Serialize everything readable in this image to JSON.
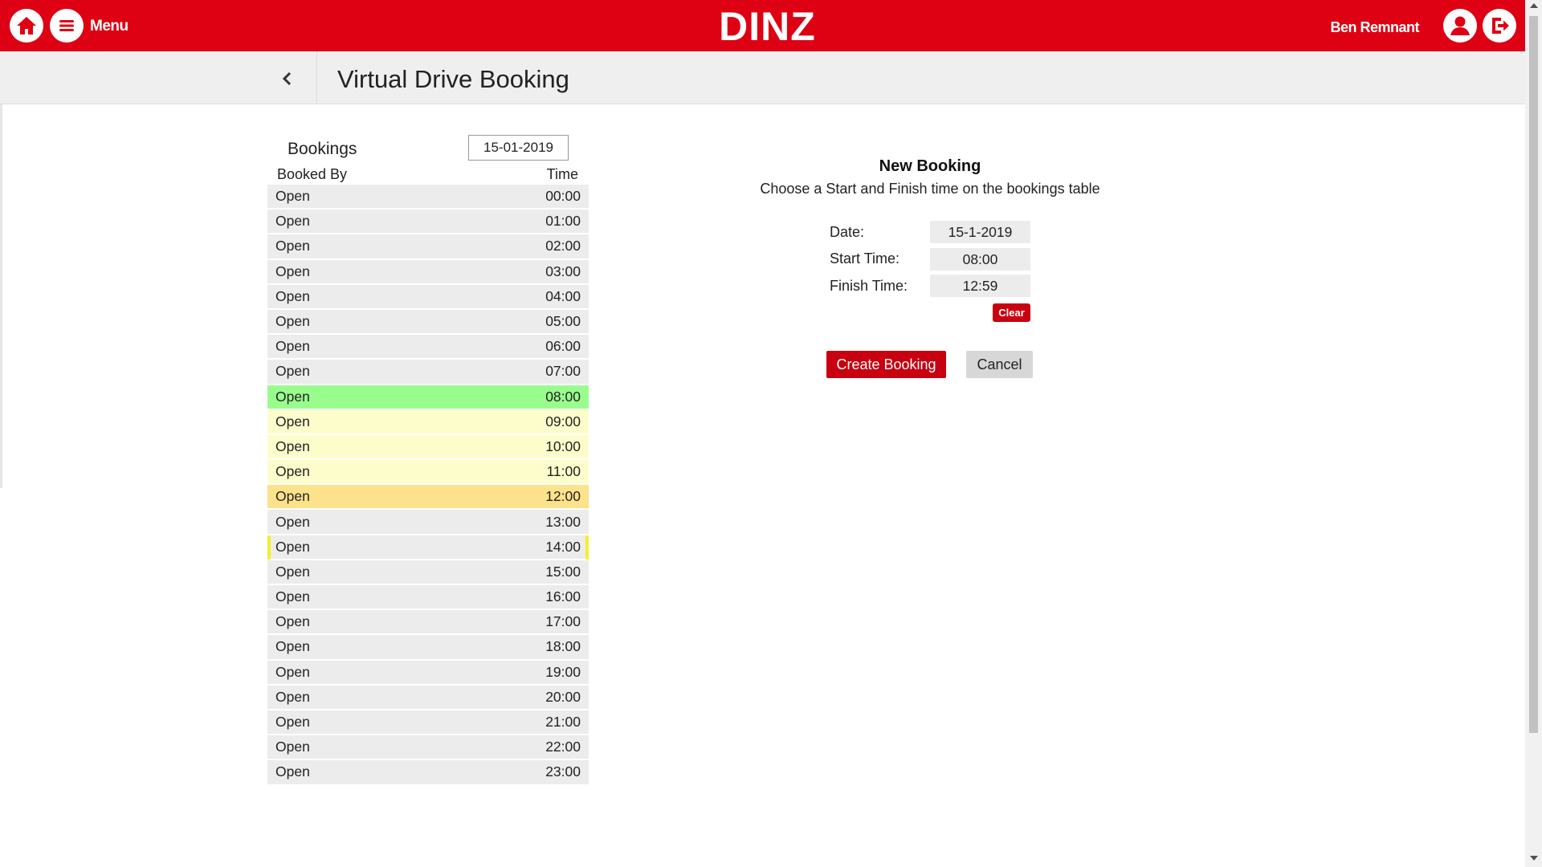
{
  "header": {
    "brand": "DINZ",
    "menu_label": "Menu",
    "user_name": "Ben Remnant",
    "brand_color": "#de0013",
    "icons": {
      "home": "home-icon",
      "menu": "hamburger-menu-icon",
      "user": "user-account-icon",
      "logout": "logout-icon"
    }
  },
  "page": {
    "title": "Virtual Drive Booking",
    "back_icon": "chevron-left-icon"
  },
  "bookings": {
    "label": "Bookings",
    "date": "15-01-2019",
    "col_booked_by": "Booked By",
    "col_time": "Time",
    "slot_colors": {
      "start": "#99fd8e",
      "range": "#fdfdcc",
      "finish": "#fde28c",
      "current_marker": "#f6ee2b",
      "default": "#ececec"
    },
    "slots": [
      {
        "booked_by": "Open",
        "time": "00:00",
        "state": "default"
      },
      {
        "booked_by": "Open",
        "time": "01:00",
        "state": "default"
      },
      {
        "booked_by": "Open",
        "time": "02:00",
        "state": "default"
      },
      {
        "booked_by": "Open",
        "time": "03:00",
        "state": "default"
      },
      {
        "booked_by": "Open",
        "time": "04:00",
        "state": "default"
      },
      {
        "booked_by": "Open",
        "time": "05:00",
        "state": "default"
      },
      {
        "booked_by": "Open",
        "time": "06:00",
        "state": "default"
      },
      {
        "booked_by": "Open",
        "time": "07:00",
        "state": "default"
      },
      {
        "booked_by": "Open",
        "time": "08:00",
        "state": "start"
      },
      {
        "booked_by": "Open",
        "time": "09:00",
        "state": "range"
      },
      {
        "booked_by": "Open",
        "time": "10:00",
        "state": "range"
      },
      {
        "booked_by": "Open",
        "time": "11:00",
        "state": "range"
      },
      {
        "booked_by": "Open",
        "time": "12:00",
        "state": "finish"
      },
      {
        "booked_by": "Open",
        "time": "13:00",
        "state": "default"
      },
      {
        "booked_by": "Open",
        "time": "14:00",
        "state": "current"
      },
      {
        "booked_by": "Open",
        "time": "15:00",
        "state": "default"
      },
      {
        "booked_by": "Open",
        "time": "16:00",
        "state": "default"
      },
      {
        "booked_by": "Open",
        "time": "17:00",
        "state": "default"
      },
      {
        "booked_by": "Open",
        "time": "18:00",
        "state": "default"
      },
      {
        "booked_by": "Open",
        "time": "19:00",
        "state": "default"
      },
      {
        "booked_by": "Open",
        "time": "20:00",
        "state": "default"
      },
      {
        "booked_by": "Open",
        "time": "21:00",
        "state": "default"
      },
      {
        "booked_by": "Open",
        "time": "22:00",
        "state": "default"
      },
      {
        "booked_by": "Open",
        "time": "23:00",
        "state": "default"
      }
    ]
  },
  "new_booking": {
    "title": "New Booking",
    "subtitle": "Choose a Start and Finish time on the bookings table",
    "date_label": "Date:",
    "date_value": "15-1-2019",
    "start_label": "Start Time:",
    "start_value": "08:00",
    "finish_label": "Finish Time:",
    "finish_value": "12:59",
    "clear_label": "Clear",
    "create_label": "Create Booking",
    "cancel_label": "Cancel",
    "button_color": "#c8000f"
  }
}
